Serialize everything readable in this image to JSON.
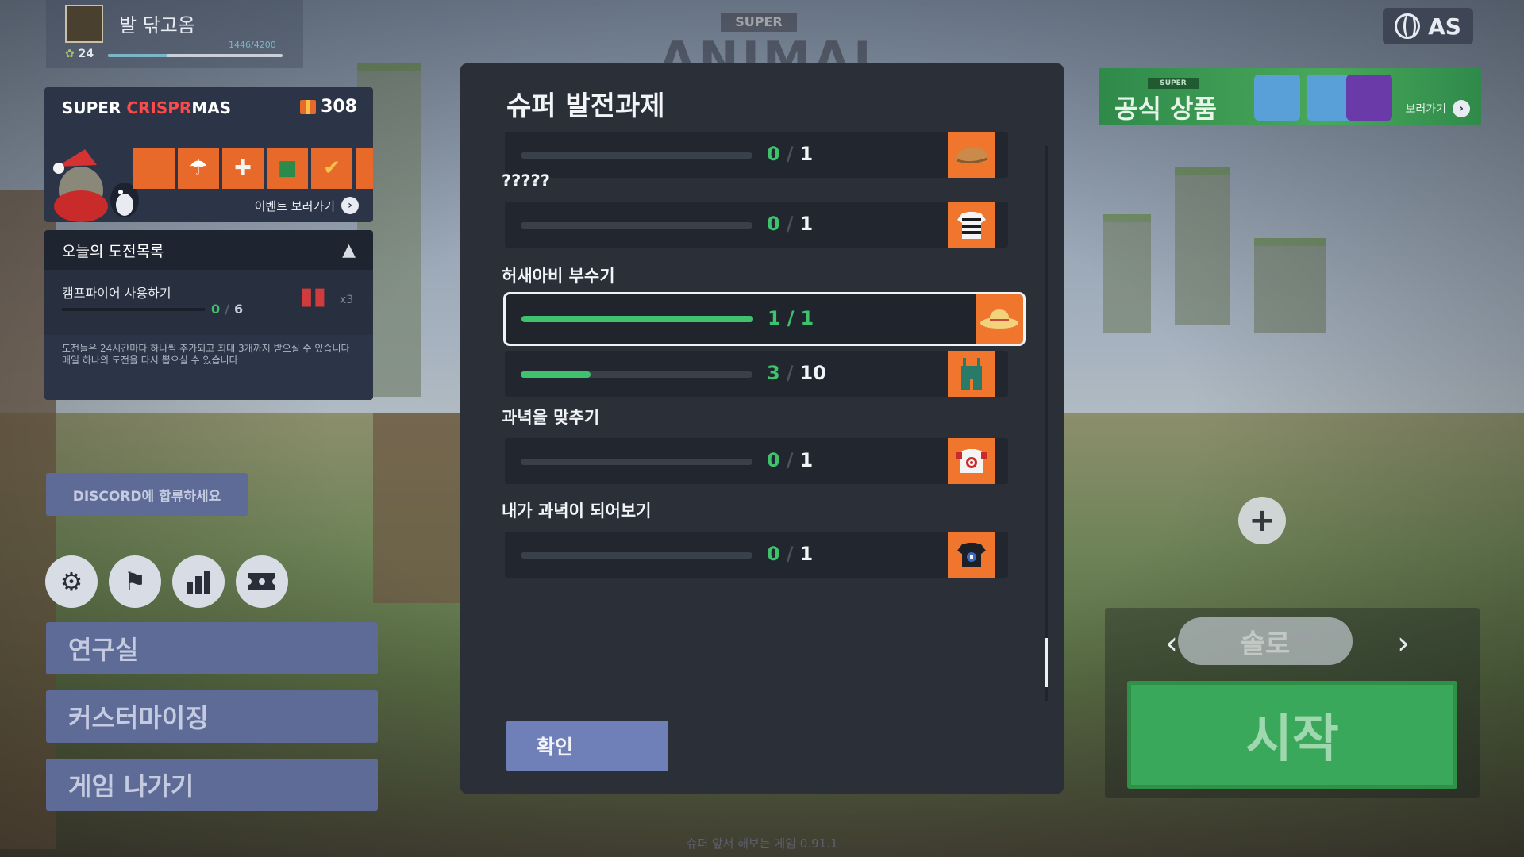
{
  "profile": {
    "name": "발 닦고옴",
    "level": "24",
    "xp": "1446/4200",
    "xp_progress": 0.34
  },
  "background": {
    "title_super": "SUPER",
    "title_main": "ANIMAL"
  },
  "event": {
    "title_part1": "SUPER ",
    "title_part2": "CRISPR",
    "title_part3": "MAS",
    "count": "308",
    "link_label": "이벤트 보러가기"
  },
  "challenges": {
    "header": "오늘의 도전목록",
    "items": [
      {
        "name": "캠프파이어 사용하기",
        "current": "0",
        "total": "6",
        "multiplier": "x3",
        "progress": 0
      }
    ],
    "footer_line1": "도전들은 24시간마다 하나씩 추가되고 최대 3개까지 받으실 수 있습니다",
    "footer_line2": "매일 하나의 도전을 다시 뽑으실 수 있습니다"
  },
  "discord_label": "DISCORD에 합류하세요",
  "icon_buttons": [
    "gear-icon",
    "flag-icon",
    "bar-chart-icon",
    "ticket-icon"
  ],
  "menu": {
    "research": "연구실",
    "customize": "커스터마이징",
    "exit": "게임 나가기"
  },
  "lang": {
    "code": "AS"
  },
  "shop": {
    "super": "SUPER",
    "title": "공식 상품",
    "link_label": "보러가기"
  },
  "mode": {
    "label": "솔로",
    "start_label": "시작"
  },
  "version": "슈퍼 앞서 해보는 게임 0.91.1",
  "modal": {
    "title": "슈퍼 발전과제",
    "tasks": [
      {
        "section": "",
        "current": "0",
        "total": "1",
        "progress": 0,
        "reward_icon": "beret-icon"
      },
      {
        "section": "?????",
        "current": "0",
        "total": "1",
        "progress": 0,
        "reward_icon": "striped-shirt-icon"
      },
      {
        "section": "허새아비 부수기",
        "current": "1",
        "total": "1",
        "progress": 1,
        "reward_icon": "straw-hat-icon",
        "selected": true
      },
      {
        "section": "",
        "current": "3",
        "total": "10",
        "progress": 0.3,
        "reward_icon": "overalls-icon"
      },
      {
        "section": "과녁을 맞추기",
        "current": "0",
        "total": "1",
        "progress": 0,
        "reward_icon": "target-shirt-icon"
      },
      {
        "section": "내가 과녁이 되어보기",
        "current": "0",
        "total": "1",
        "progress": 0,
        "reward_icon": "number-shirt-icon"
      }
    ],
    "confirm_label": "확인"
  }
}
